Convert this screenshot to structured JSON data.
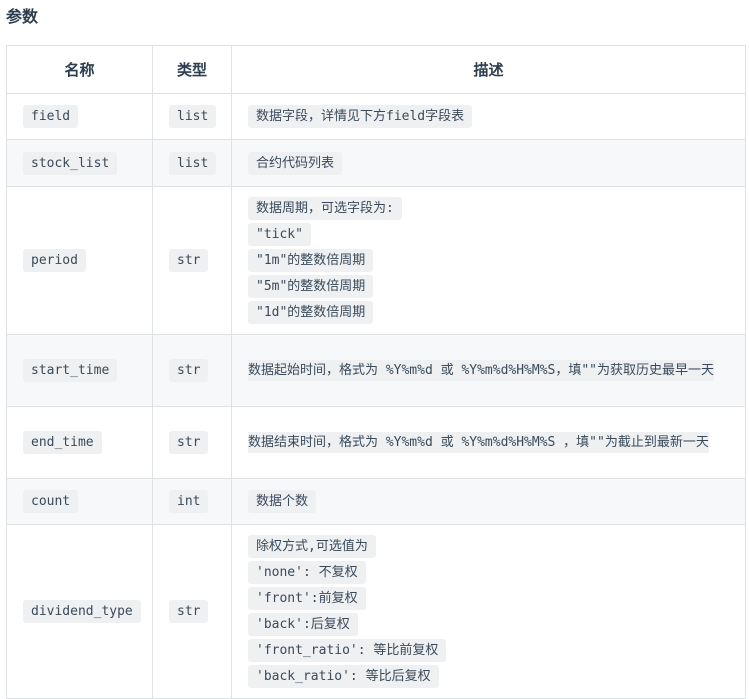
{
  "section_title": "参数",
  "table": {
    "headers": [
      "名称",
      "类型",
      "描述"
    ],
    "rows": [
      {
        "name": "field",
        "type": "list",
        "desc": [
          "数据字段，详情见下方field字段表"
        ]
      },
      {
        "name": "stock_list",
        "type": "list",
        "desc": [
          "合约代码列表"
        ]
      },
      {
        "name": "period",
        "type": "str",
        "desc": [
          "数据周期，可选字段为:",
          "\"tick\"",
          "\"1m\"的整数倍周期",
          "\"5m\"的整数倍周期",
          "\"1d\"的整数倍周期"
        ]
      },
      {
        "name": "start_time",
        "type": "str",
        "desc": [
          "数据起始时间，格式为 %Y%m%d 或 %Y%m%d%H%M%S，填\"\"为获取历史最早一天"
        ]
      },
      {
        "name": "end_time",
        "type": "str",
        "desc": [
          "数据结束时间，格式为 %Y%m%d 或 %Y%m%d%H%M%S ，填\"\"为截止到最新一天"
        ]
      },
      {
        "name": "count",
        "type": "int",
        "desc": [
          "数据个数"
        ]
      },
      {
        "name": "dividend_type",
        "type": "str",
        "desc": [
          "除权方式,可选值为",
          "'none': 不复权",
          "'front':前复权",
          "'back':后复权",
          "'front_ratio': 等比前复权",
          "'back_ratio': 等比后复权"
        ]
      }
    ]
  }
}
